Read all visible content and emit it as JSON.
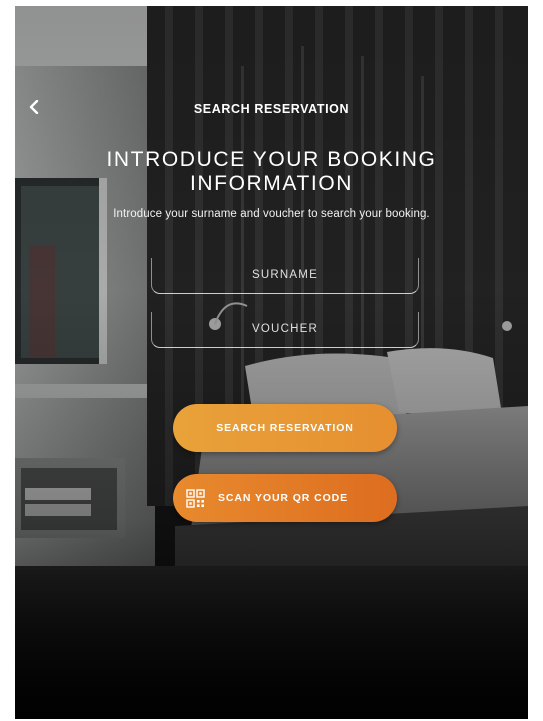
{
  "header": {
    "title": "SEARCH RESERVATION",
    "back_icon": "chevron-left-icon"
  },
  "content": {
    "title": "INTRODUCE YOUR BOOKING INFORMATION",
    "subtitle": "Introduce your surname and voucher to search your booking."
  },
  "form": {
    "surname_placeholder": "SURNAME",
    "voucher_placeholder": "VOUCHER"
  },
  "actions": {
    "search_label": "SEARCH RESERVATION",
    "qr_label": "SCAN YOUR QR CODE",
    "qr_icon": "qr-code-icon"
  },
  "colors": {
    "accent_light": "#e9a23a",
    "accent_dark": "#dd6d1f",
    "text": "#ffffff"
  }
}
